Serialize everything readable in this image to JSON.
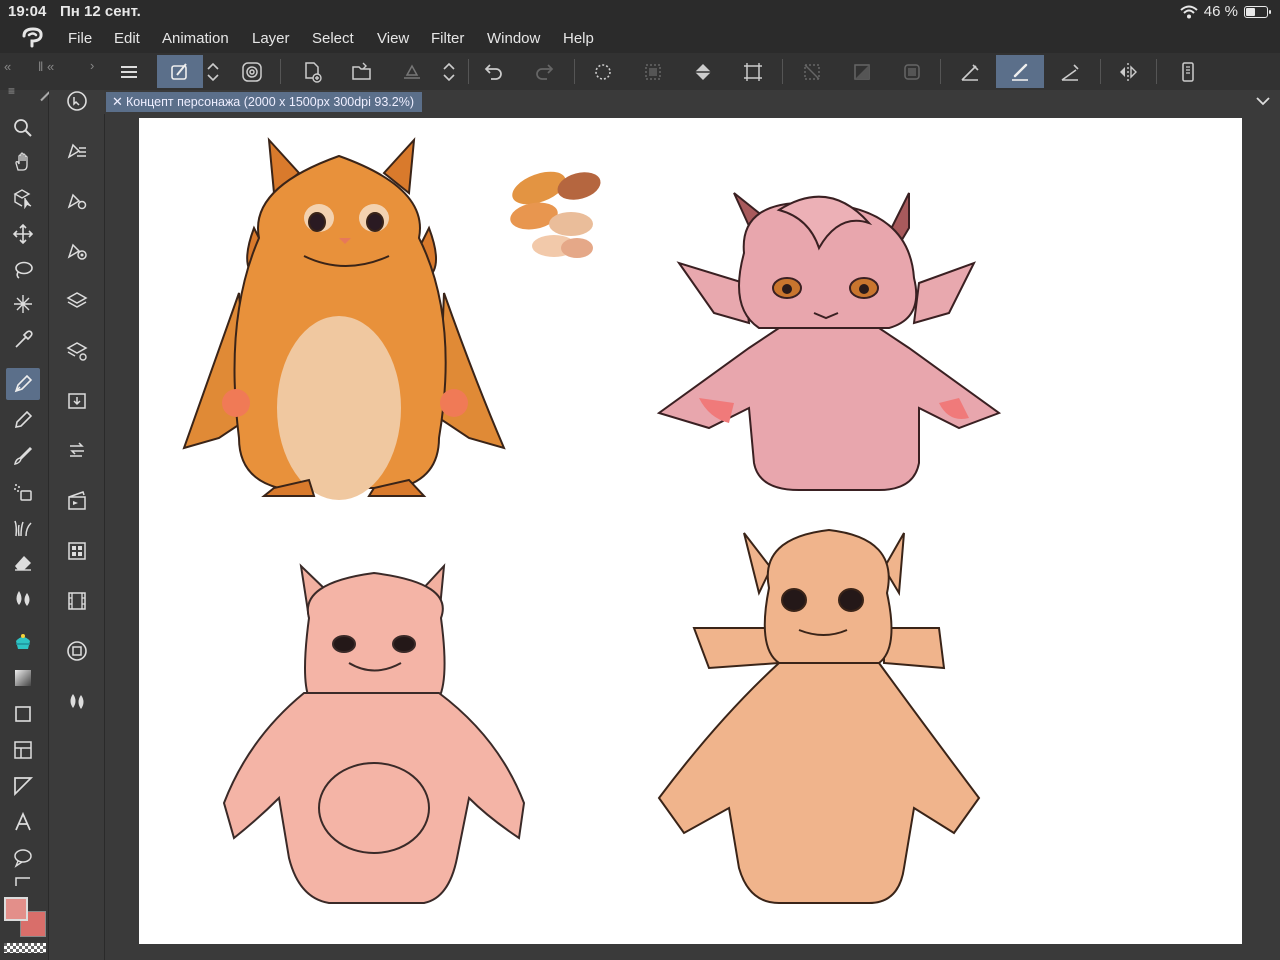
{
  "status": {
    "time": "19:04",
    "date": "Пн 12 сент.",
    "battery": "46 %",
    "battery_level": 0.46
  },
  "menu": {
    "items": [
      "File",
      "Edit",
      "Animation",
      "Layer",
      "Select",
      "View",
      "Filter",
      "Window",
      "Help"
    ]
  },
  "toolbar": {
    "icons": [
      "menu-icon",
      "quick-access-icon",
      "up-down-icon",
      "spiral-icon",
      "new-canvas-icon",
      "open-folder-icon",
      "save-icon",
      "up-down-icon-2",
      "undo-icon",
      "redo-icon",
      "selection-marquee-icon",
      "clear-selection-icon",
      "fill-bucket-icon",
      "crop-transform-icon",
      "deselect-icon",
      "invert-selection-icon",
      "selection-layer-icon",
      "ruler-snap-icon",
      "brush-snap-icon",
      "special-ruler-snap-icon",
      "flip-horizontal-icon",
      "device-icon"
    ]
  },
  "document": {
    "tab_title": "Концепт персонажа (2000 x 1500px 300dpi 93.2%)"
  },
  "colors": {
    "main": "#e38f8a",
    "sub": "#d96e6a",
    "accent": "#5b6f8a"
  },
  "tools": [
    "zoom-icon",
    "hand-icon",
    "operation-icon",
    "move-icon",
    "lasso-select-icon",
    "auto-select-icon",
    "eyedropper-icon",
    "pen-icon",
    "pencil-icon",
    "brush-icon",
    "airbrush-icon",
    "decoration-icon",
    "eraser-icon",
    "blend-icon",
    "fill-icon",
    "gradient-icon",
    "figure-icon",
    "frame-icon",
    "ruler-icon",
    "text-icon",
    "balloon-icon"
  ],
  "subtools": [
    "navigator-icon",
    "sub-tool-icon",
    "tool-property-icon",
    "brush-size-icon",
    "layer-icon",
    "layer-property-icon",
    "import-icon",
    "history-icon",
    "animation-icon",
    "material-icon",
    "timeline-icon",
    "color-circle-icon",
    "color-mix-icon"
  ]
}
